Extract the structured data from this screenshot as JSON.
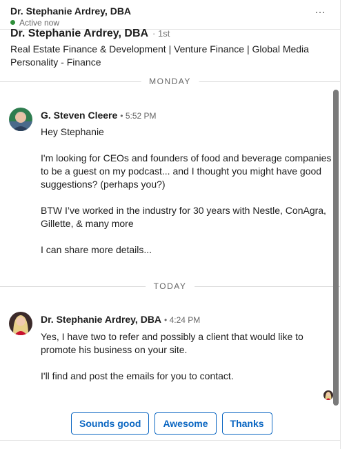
{
  "header": {
    "name": "Dr. Stephanie Ardrey, DBA",
    "status": "Active now",
    "more_label": "…"
  },
  "profile": {
    "name": "Dr. Stephanie Ardrey, DBA",
    "degree": "· 1st",
    "headline": "Real Estate Finance & Development | Venture Finance | Global Media Personality - Finance"
  },
  "days": {
    "monday": "MONDAY",
    "today": "TODAY"
  },
  "messages": [
    {
      "sender": "G. Steven Cleere",
      "time": "• 5:52 PM",
      "paragraphs": [
        "Hey Stephanie",
        "I'm looking for CEOs and founders of food and beverage companies to be a guest on my podcast... and I thought you might have good suggestions? (perhaps you?)",
        "BTW I’ve worked in the industry for 30 years with Nestle, ConAgra, Gillette, & many more",
        "I can share more details..."
      ]
    },
    {
      "sender": "Dr. Stephanie Ardrey, DBA",
      "time": "• 4:24 PM",
      "paragraphs": [
        "Yes, I have two to refer and possibly a client that would like to promote his business on your site.",
        "I'll find and post the emails for you to contact."
      ]
    }
  ],
  "quick_replies": [
    "Sounds good",
    "Awesome",
    "Thanks"
  ],
  "colors": {
    "accent": "#0a66c2",
    "online": "#2f8f3a"
  }
}
